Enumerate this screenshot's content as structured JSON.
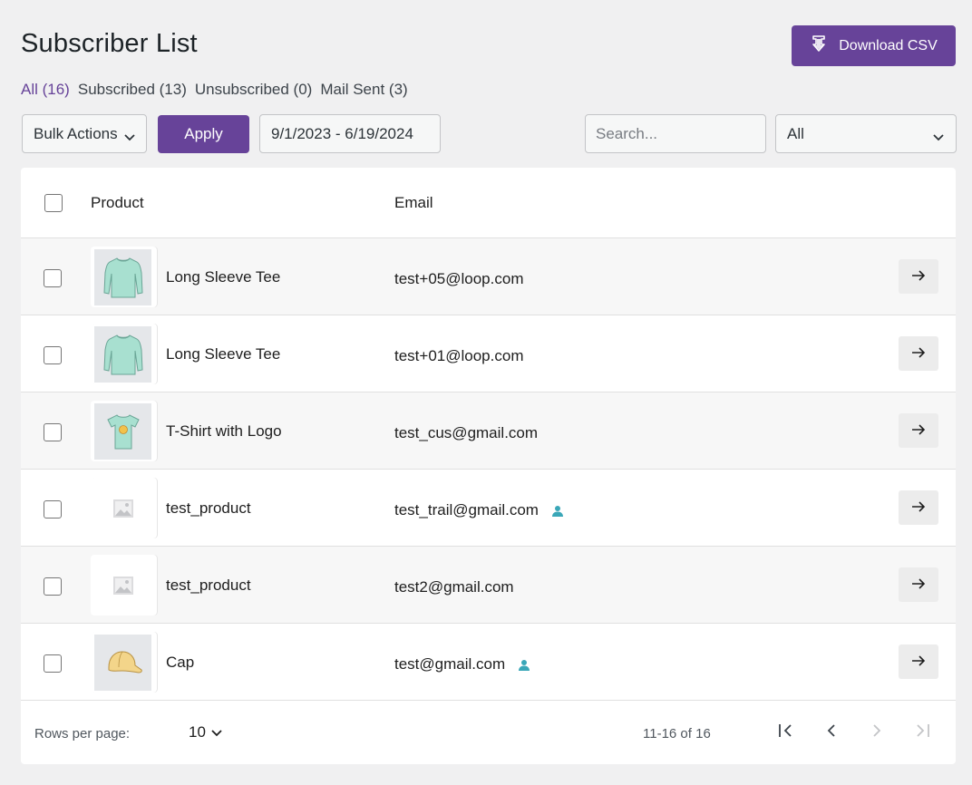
{
  "header": {
    "title": "Subscriber List",
    "download_label": "Download CSV"
  },
  "filters": [
    {
      "label": "All (16)",
      "active": true
    },
    {
      "label": "Subscribed (13)",
      "active": false
    },
    {
      "label": "Unsubscribed (0)",
      "active": false
    },
    {
      "label": "Mail Sent (3)",
      "active": false
    }
  ],
  "toolbar": {
    "bulk_actions": "Bulk Actions",
    "apply_label": "Apply",
    "date_range": "9/1/2023 - 6/19/2024",
    "search_placeholder": "Search...",
    "status_value": "All"
  },
  "table": {
    "columns": {
      "product": "Product",
      "email": "Email"
    },
    "rows": [
      {
        "product": "Long Sleeve Tee",
        "email": "test+05@loop.com",
        "image": "long-sleeve-tee",
        "user": false
      },
      {
        "product": "Long Sleeve Tee",
        "email": "test+01@loop.com",
        "image": "long-sleeve-tee",
        "user": false
      },
      {
        "product": "T-Shirt with Logo",
        "email": "test_cus@gmail.com",
        "image": "tshirt-logo",
        "user": false
      },
      {
        "product": "test_product",
        "email": "test_trail@gmail.com",
        "image": "placeholder",
        "user": true
      },
      {
        "product": "test_product",
        "email": "test2@gmail.com",
        "image": "placeholder",
        "user": false
      },
      {
        "product": "Cap",
        "email": "test@gmail.com",
        "image": "cap",
        "user": true
      }
    ]
  },
  "footer": {
    "rows_label": "Rows per page:",
    "rows_value": "10",
    "range": "11-16 of 16"
  },
  "colors": {
    "accent": "#674399",
    "user_icon": "#3aa7b8",
    "thumb_bg": "#e5e7ea",
    "garment": "#a8e0d0"
  }
}
